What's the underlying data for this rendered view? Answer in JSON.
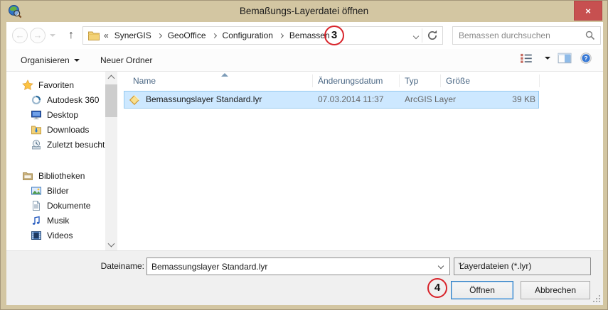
{
  "window": {
    "title": "Bemaßungs-Layerdatei öffnen",
    "close_glyph": "×"
  },
  "addressbar": {
    "crumb_prefix": "«",
    "crumbs": [
      "SynerGIS",
      "GeoOffice",
      "Configuration",
      "Bemassen"
    ],
    "annotation": "3",
    "search_placeholder": "Bemassen durchsuchen"
  },
  "toolbar": {
    "organize": "Organisieren",
    "new_folder": "Neuer Ordner"
  },
  "sidebar": {
    "groups": [
      {
        "label": "Favoriten",
        "items": [
          "Autodesk 360",
          "Desktop",
          "Downloads",
          "Zuletzt besucht"
        ]
      },
      {
        "label": "Bibliotheken",
        "items": [
          "Bilder",
          "Dokumente",
          "Musik",
          "Videos"
        ]
      }
    ]
  },
  "filelist": {
    "columns": [
      "Name",
      "Änderungsdatum",
      "Typ",
      "Größe"
    ],
    "rows": [
      {
        "name": "Bemassungslayer Standard.lyr",
        "modified": "07.03.2014 11:37",
        "type": "ArcGIS Layer",
        "size": "39 KB",
        "selected": true,
        "icon": "lyr-diamond-icon"
      }
    ]
  },
  "footer": {
    "filename_label": "Dateiname:",
    "filename_value": "Bemassungslayer Standard.lyr",
    "filetype_value": "Layerdateien (*.lyr)",
    "open": "Öffnen",
    "cancel": "Abbrechen",
    "annotation": "4"
  },
  "colors": {
    "frame": "#d3c6a2",
    "close_red": "#c75050",
    "selection_bg": "#cde8ff",
    "selection_border": "#95c8ef",
    "annotation_red": "#d8232a",
    "header_text": "#4a6784",
    "footer_bg": "#f0f0f0"
  }
}
